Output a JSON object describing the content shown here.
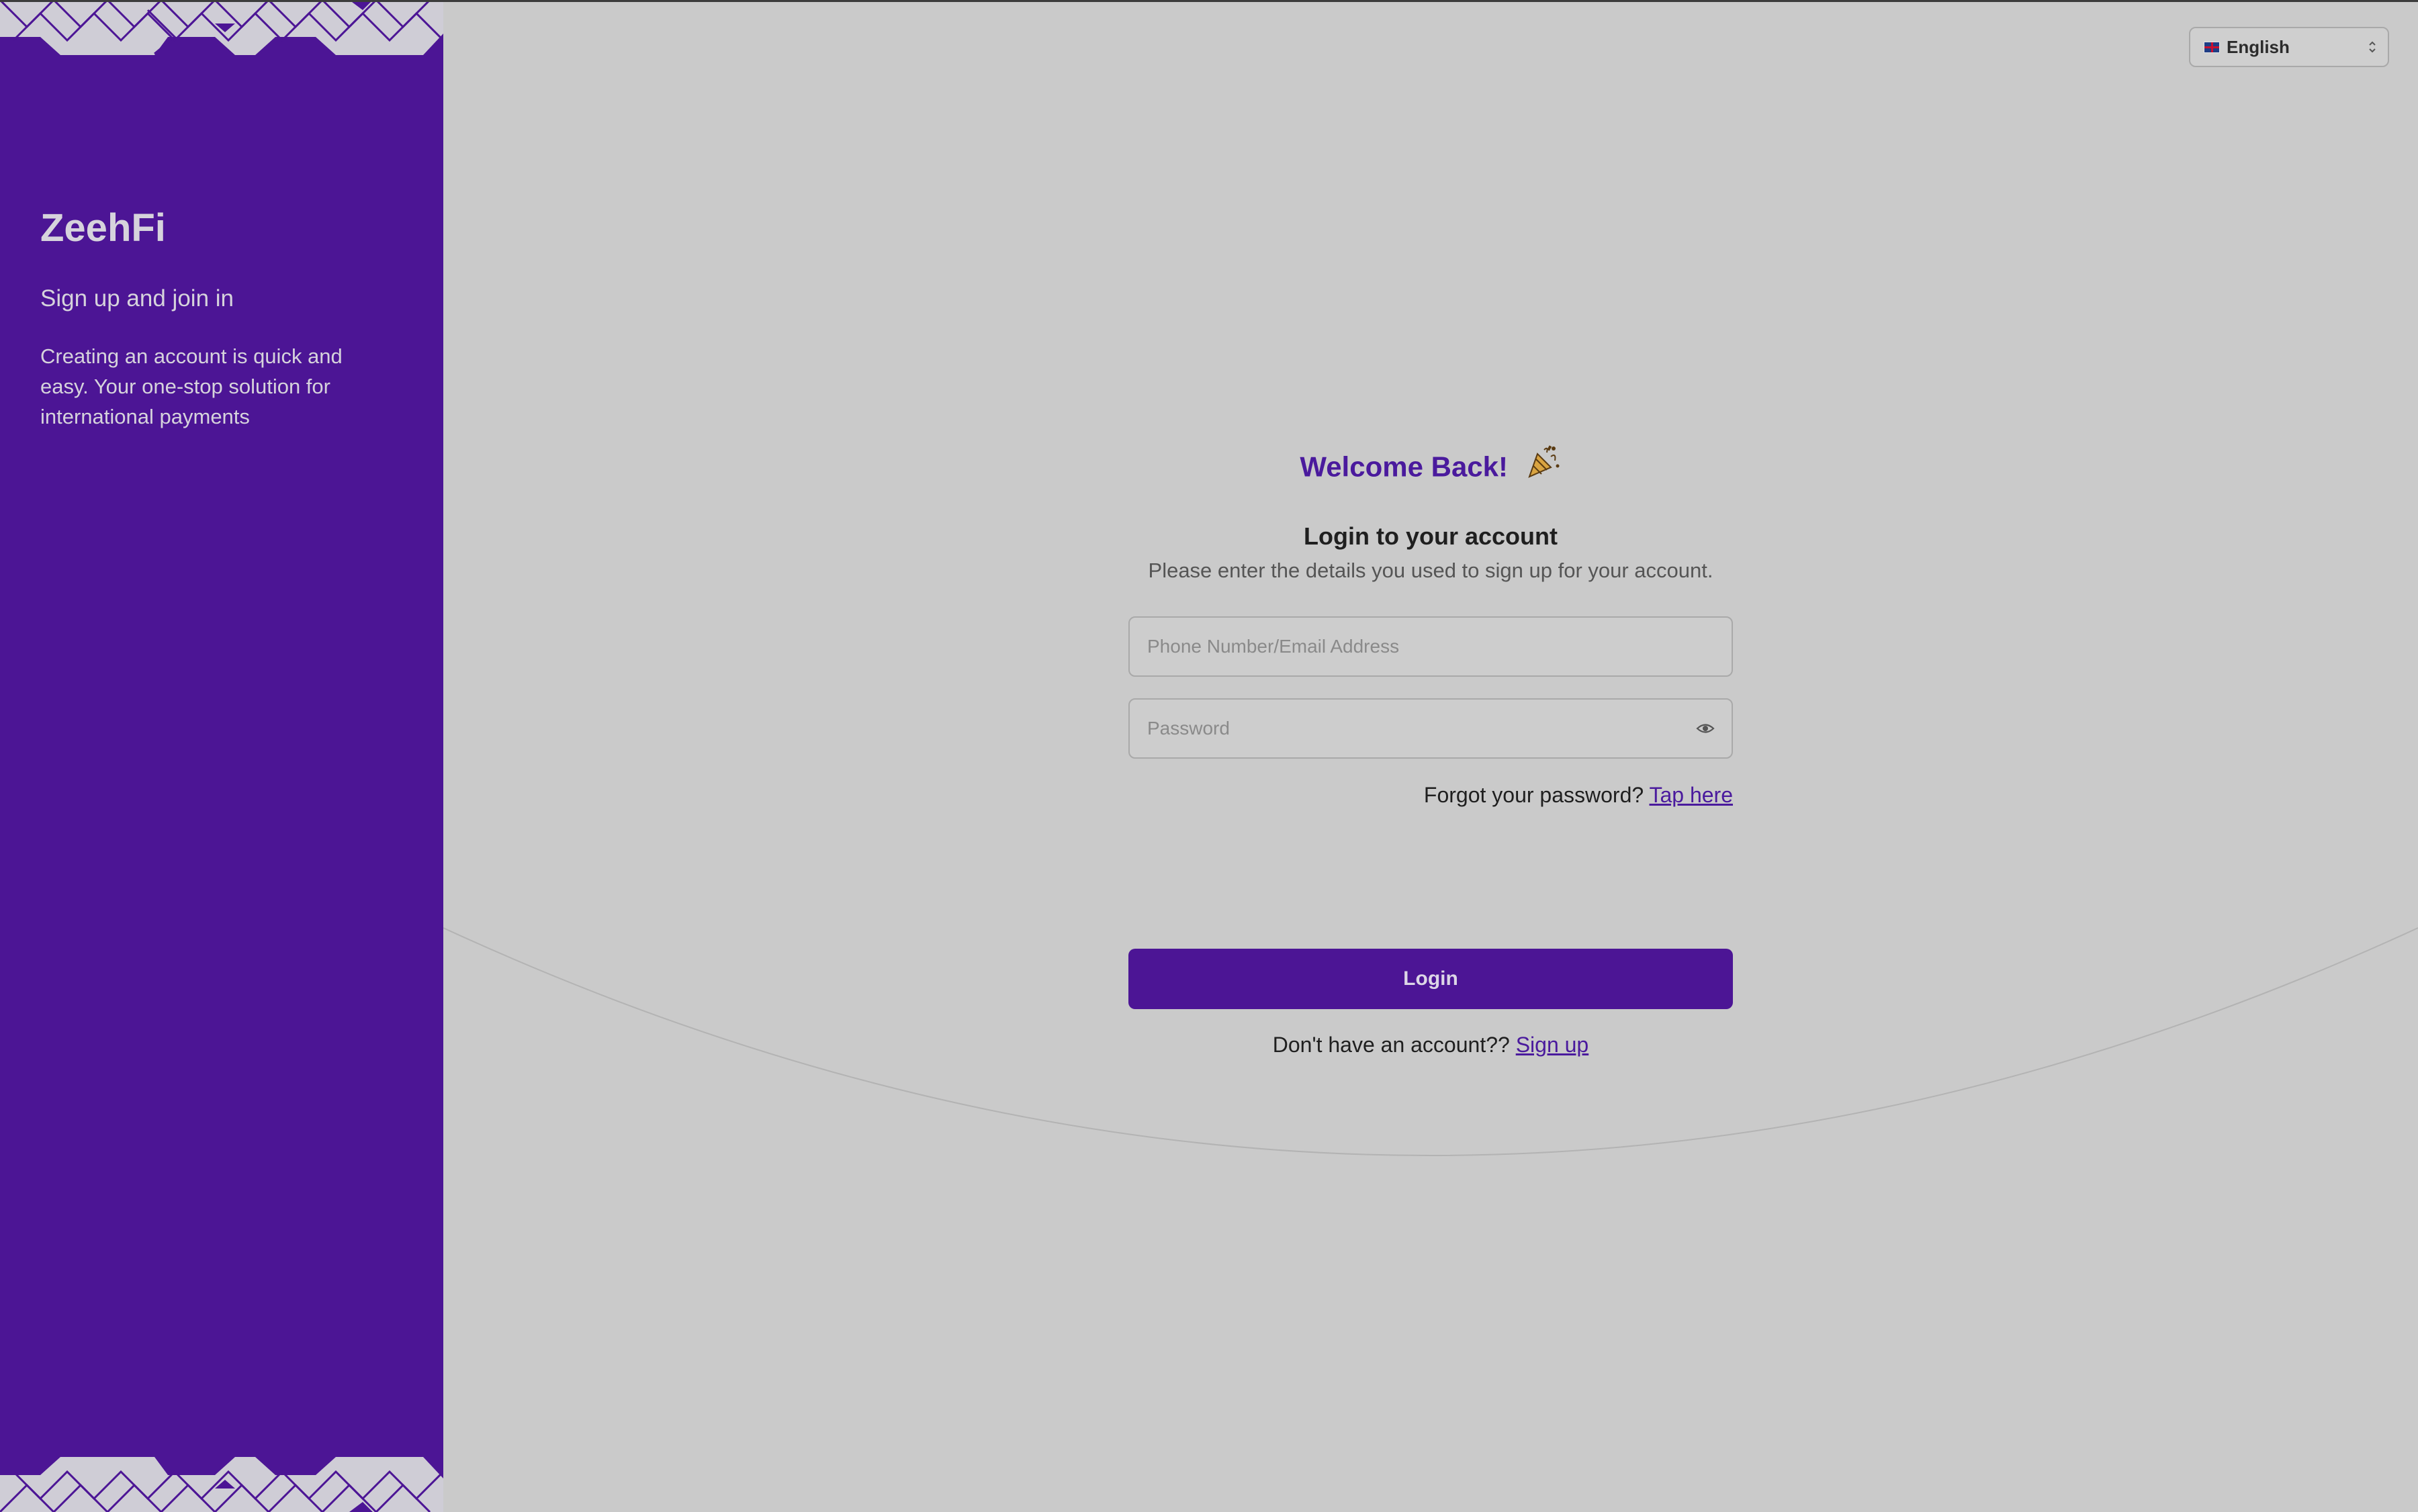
{
  "sidebar": {
    "brand": "ZeehFi",
    "tagline": "Sign up and join in",
    "description": "Creating an account is quick and easy. Your one-stop solution for international payments"
  },
  "language": {
    "selected": "English",
    "flag_icon": "uk-flag-icon",
    "chevron_icon": "chevron-updown-icon"
  },
  "login": {
    "welcome": "Welcome Back!",
    "welcome_icon": "party-popper-icon",
    "title": "Login to your account",
    "subtitle": "Please enter the details you used to sign up for your account.",
    "phone_placeholder": "Phone Number/Email Address",
    "password_placeholder": "Password",
    "password_icon": "eye-icon",
    "forgot_text": "Forgot your password?",
    "forgot_link": "Tap here",
    "button_label": "Login",
    "signup_text": "Don't have an account??",
    "signup_link": "Sign up"
  },
  "colors": {
    "brand_purple": "#4c1595",
    "background": "#cacaca",
    "accent_text": "#4a1a9d"
  }
}
